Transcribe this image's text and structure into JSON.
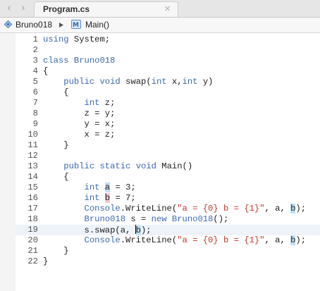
{
  "tab": {
    "title": "Program.cs"
  },
  "nav": {
    "back": "‹",
    "forward": "›",
    "close": "×"
  },
  "breadcrumb": {
    "project": "Bruno018",
    "method": "Main()"
  },
  "code": {
    "current_line_index": 18,
    "lines": [
      {
        "n": "1",
        "t": [
          [
            "using",
            "kw"
          ],
          [
            " System;",
            ""
          ]
        ]
      },
      {
        "n": "2",
        "t": []
      },
      {
        "n": "3",
        "t": [
          [
            "class",
            "kw"
          ],
          [
            " ",
            ""
          ],
          [
            "Bruno018",
            "kw"
          ]
        ]
      },
      {
        "n": "4",
        "t": [
          [
            "{",
            ""
          ]
        ]
      },
      {
        "n": "5",
        "t": [
          [
            "    ",
            ""
          ],
          [
            "public",
            "kw"
          ],
          [
            " ",
            ""
          ],
          [
            "void",
            "kw"
          ],
          [
            " swap(",
            ""
          ],
          [
            "int",
            "kw"
          ],
          [
            " x,",
            ""
          ],
          [
            "int",
            "kw"
          ],
          [
            " y)",
            ""
          ]
        ]
      },
      {
        "n": "6",
        "t": [
          [
            "    {",
            ""
          ]
        ]
      },
      {
        "n": "7",
        "t": [
          [
            "        ",
            ""
          ],
          [
            "int",
            "kw"
          ],
          [
            " z;",
            ""
          ]
        ]
      },
      {
        "n": "8",
        "t": [
          [
            "        z = y;",
            ""
          ]
        ]
      },
      {
        "n": "9",
        "t": [
          [
            "        y = x;",
            ""
          ]
        ]
      },
      {
        "n": "10",
        "t": [
          [
            "        x = z;",
            ""
          ]
        ]
      },
      {
        "n": "11",
        "t": [
          [
            "    }",
            ""
          ]
        ]
      },
      {
        "n": "12",
        "t": []
      },
      {
        "n": "13",
        "t": [
          [
            "    ",
            ""
          ],
          [
            "public",
            "kw"
          ],
          [
            " ",
            ""
          ],
          [
            "static",
            "kw"
          ],
          [
            " ",
            ""
          ],
          [
            "void",
            "kw"
          ],
          [
            " Main()",
            ""
          ]
        ]
      },
      {
        "n": "14",
        "t": [
          [
            "    {",
            ""
          ]
        ]
      },
      {
        "n": "15",
        "t": [
          [
            "        ",
            ""
          ],
          [
            "int",
            "kw"
          ],
          [
            " ",
            ""
          ],
          [
            "a",
            "hl"
          ],
          [
            " = 3;",
            ""
          ]
        ]
      },
      {
        "n": "16",
        "t": [
          [
            "        ",
            ""
          ],
          [
            "int",
            "kw"
          ],
          [
            " ",
            ""
          ],
          [
            "b",
            "hl2"
          ],
          [
            " = 7;",
            ""
          ]
        ]
      },
      {
        "n": "17",
        "t": [
          [
            "        ",
            ""
          ],
          [
            "Console",
            "kw"
          ],
          [
            ".WriteLine(",
            ""
          ],
          [
            "\"a = {0} b = {1}\"",
            "str"
          ],
          [
            ", a, ",
            ""
          ],
          [
            "b",
            "hl"
          ],
          [
            ");",
            ""
          ]
        ]
      },
      {
        "n": "18",
        "t": [
          [
            "        ",
            ""
          ],
          [
            "Bruno018",
            "kw"
          ],
          [
            " s = ",
            ""
          ],
          [
            "new",
            "kw"
          ],
          [
            " ",
            ""
          ],
          [
            "Bruno018",
            "kw"
          ],
          [
            "();",
            ""
          ]
        ]
      },
      {
        "n": "19",
        "t": [
          [
            "        s.swap(a, ",
            ""
          ],
          [
            "b",
            "hl caret"
          ],
          [
            ");",
            ""
          ]
        ]
      },
      {
        "n": "20",
        "t": [
          [
            "        ",
            ""
          ],
          [
            "Console",
            "kw"
          ],
          [
            ".WriteLine(",
            ""
          ],
          [
            "\"a = {0} b = {1}\"",
            "str"
          ],
          [
            ", a, ",
            ""
          ],
          [
            "b",
            "hl"
          ],
          [
            ");",
            ""
          ]
        ]
      },
      {
        "n": "21",
        "t": [
          [
            "    }",
            ""
          ]
        ]
      },
      {
        "n": "22",
        "t": [
          [
            "}",
            ""
          ]
        ]
      }
    ]
  }
}
